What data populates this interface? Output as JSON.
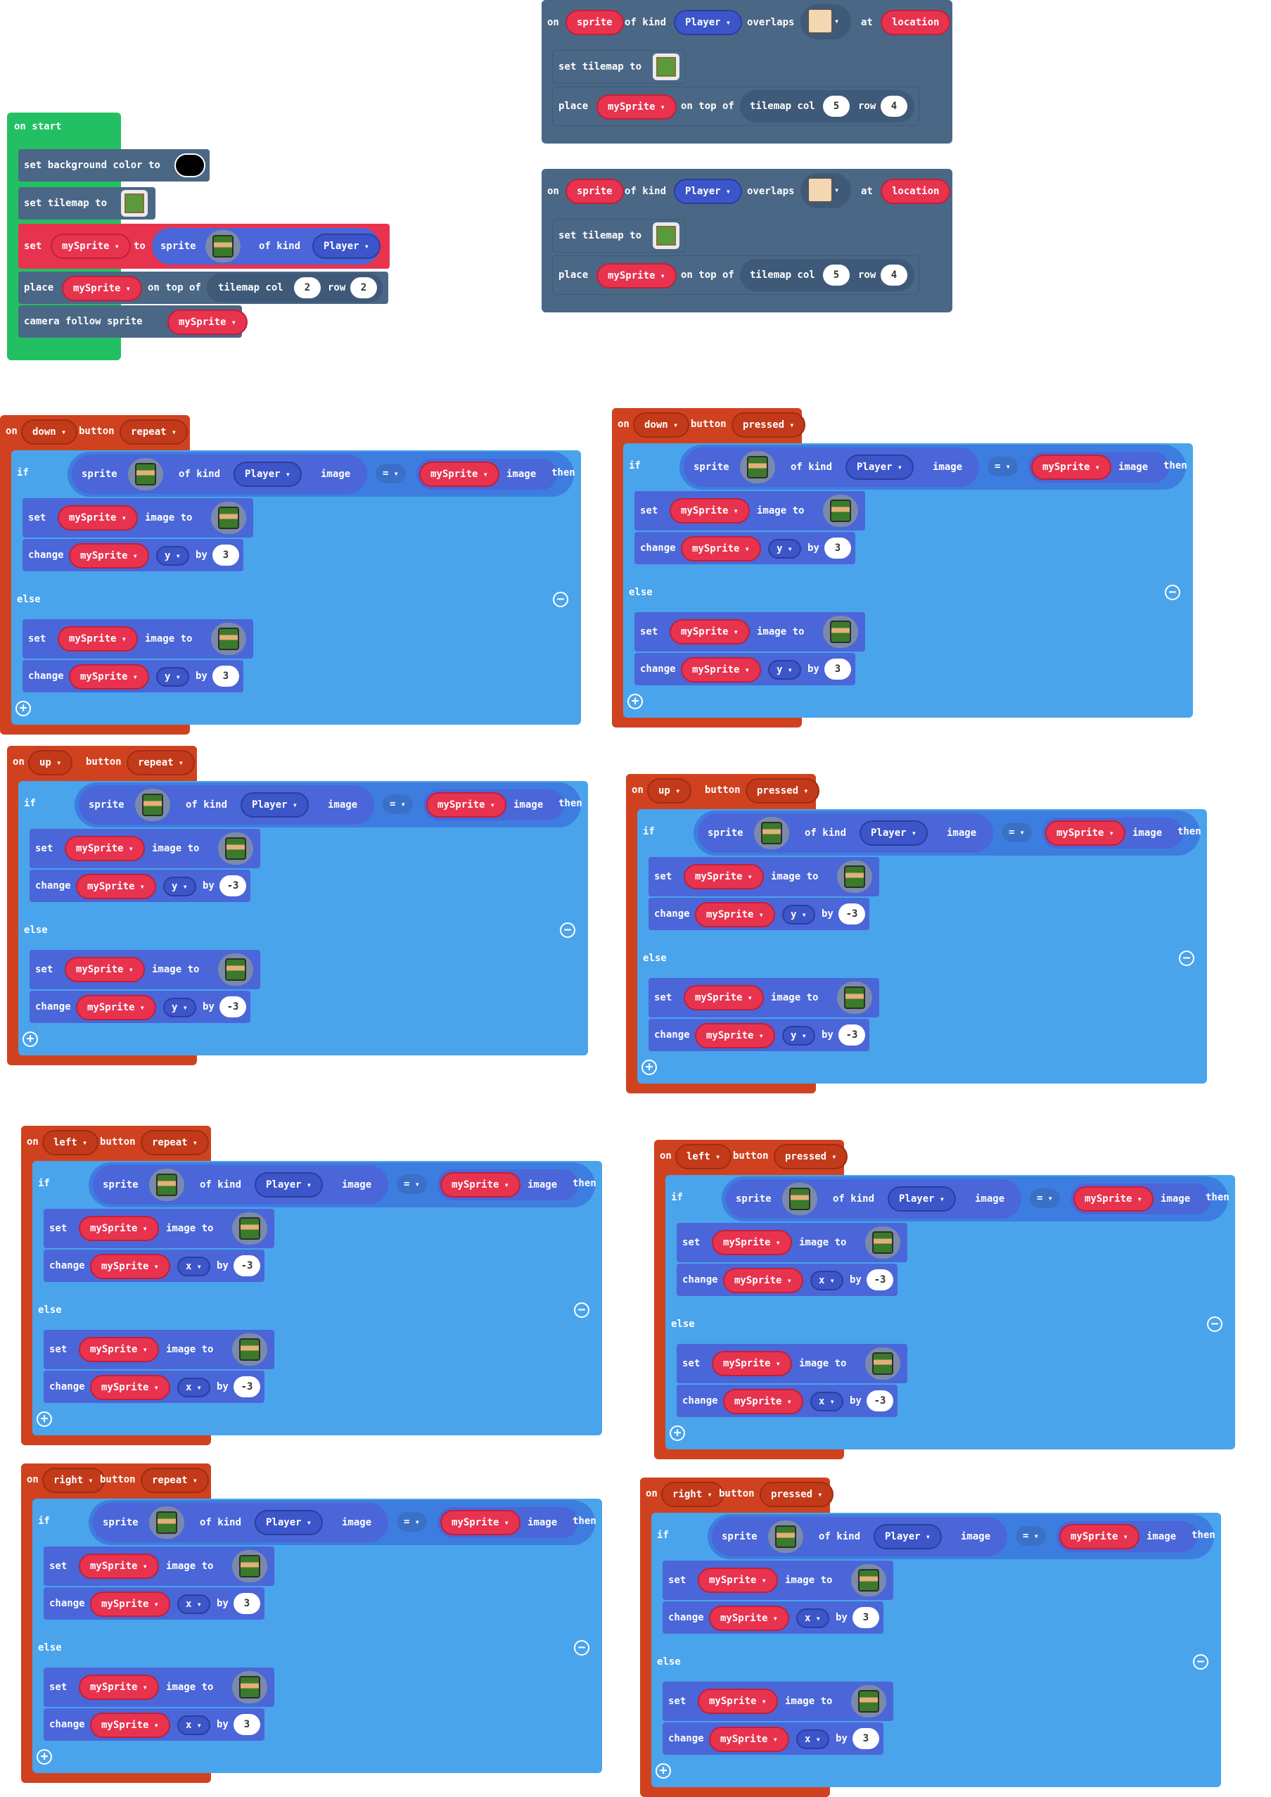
{
  "labels": {
    "on": "on",
    "on_start": "on start",
    "set": "set",
    "to": "to",
    "of_kind": "of kind",
    "sprite": "sprite",
    "place": "place",
    "on_top_of": "on top of",
    "tilemap_col": "tilemap col",
    "row": "row",
    "if": "if",
    "then": "then",
    "else": "else",
    "image": "image",
    "image_to": "image to",
    "change": "change",
    "by": "by",
    "button": "button",
    "overlaps": "overlaps",
    "at": "at",
    "location": "location",
    "set_tilemap_to": "set tilemap to",
    "set_background_color_to": "set background color to",
    "camera_follow_sprite": "camera follow sprite",
    "eq": "="
  },
  "var_name": "mySprite",
  "kind_name": "Player",
  "start": {
    "place_col": "2",
    "place_row": "2"
  },
  "overlaps": [
    {
      "col": "5",
      "row": "4"
    },
    {
      "col": "5",
      "row": "4"
    }
  ],
  "handlers": [
    {
      "button": "down",
      "mode": "repeat",
      "axis": "y",
      "then_by": "3",
      "else_by": "3"
    },
    {
      "button": "down",
      "mode": "pressed",
      "axis": "y",
      "then_by": "3",
      "else_by": "3"
    },
    {
      "button": "up",
      "mode": "repeat",
      "axis": "y",
      "then_by": "-3",
      "else_by": "-3"
    },
    {
      "button": "up",
      "mode": "pressed",
      "axis": "y",
      "then_by": "-3",
      "else_by": "-3"
    },
    {
      "button": "left",
      "mode": "repeat",
      "axis": "x",
      "then_by": "-3",
      "else_by": "-3"
    },
    {
      "button": "left",
      "mode": "pressed",
      "axis": "x",
      "then_by": "-3",
      "else_by": "-3"
    },
    {
      "button": "right",
      "mode": "repeat",
      "axis": "x",
      "then_by": "3",
      "else_by": "3"
    },
    {
      "button": "right",
      "mode": "pressed",
      "axis": "x",
      "then_by": "3",
      "else_by": "3"
    }
  ],
  "colors": {
    "events": "#d0421f",
    "loops": "#23c063",
    "scene": "#4b6786",
    "logic": "#4aa4eb",
    "sprites": "#4a66d8",
    "variables": "#e8334f"
  }
}
